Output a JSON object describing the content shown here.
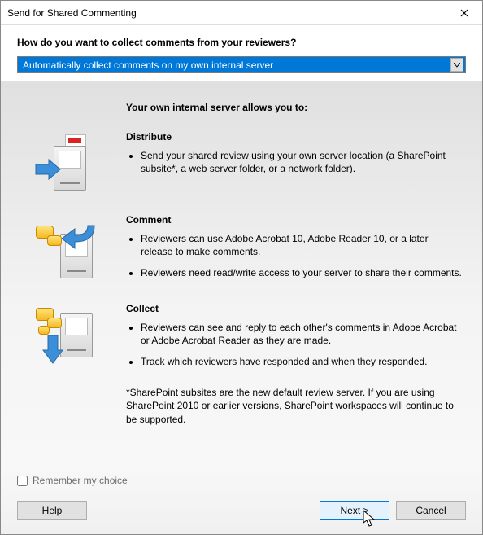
{
  "window": {
    "title": "Send for Shared Commenting"
  },
  "header": {
    "question": "How do you want to collect comments from your reviewers?",
    "dropdown_value": "Automatically collect comments on my own internal server"
  },
  "intro": "Your own internal server allows you to:",
  "sections": {
    "distribute": {
      "title": "Distribute",
      "bullets": [
        "Send your shared review using your own server location (a SharePoint subsite*, a web server folder, or a network folder)."
      ]
    },
    "comment": {
      "title": "Comment",
      "bullets": [
        "Reviewers can use Adobe Acrobat 10, Adobe Reader 10, or a later release to make comments.",
        "Reviewers need read/write access to your server to share their comments."
      ]
    },
    "collect": {
      "title": "Collect",
      "bullets": [
        "Reviewers can see and reply to each other's comments in Adobe Acrobat or Adobe Acrobat Reader as they are made.",
        "Track which reviewers have responded and when they responded."
      ]
    }
  },
  "footnote": "*SharePoint subsites are the new default review server. If you are using SharePoint 2010 or earlier versions, SharePoint workspaces will continue to be supported.",
  "footer": {
    "remember_label": "Remember my choice",
    "help": "Help",
    "next": "Next >",
    "cancel": "Cancel"
  }
}
